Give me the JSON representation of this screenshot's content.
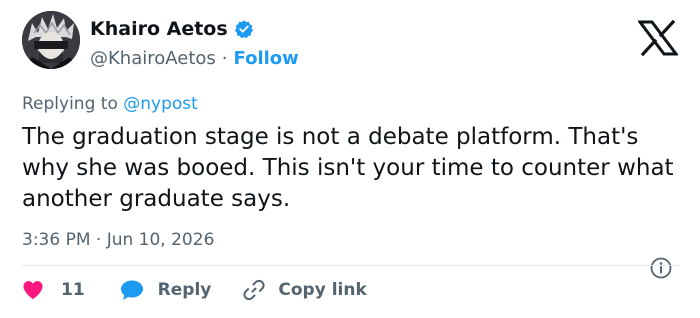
{
  "author": {
    "name": "Khairo Aetos",
    "handle": "@KhairoAetos",
    "separator": "·",
    "follow_label": "Follow"
  },
  "tweet": {
    "replying_prefix": "Replying to",
    "replying_to": "@nypost",
    "text": "The graduation stage is not a debate platform. That's why she was booed. This isn't your time to counter what another graduate says.",
    "timestamp": "3:36 PM · Jun 10, 2026"
  },
  "actions": {
    "like_count": "11",
    "reply_label": "Reply",
    "copy_link_label": "Copy link"
  },
  "icons": {
    "verified": "verified-badge-icon",
    "logo": "x-logo-icon",
    "info": "info-icon",
    "heart": "heart-icon",
    "reply": "speech-bubble-icon",
    "link": "link-icon"
  },
  "colors": {
    "accent": "#1d9bf0",
    "text": "#0f1419",
    "muted": "#536471",
    "like": "#f91880",
    "divider": "#e6ecf0"
  }
}
